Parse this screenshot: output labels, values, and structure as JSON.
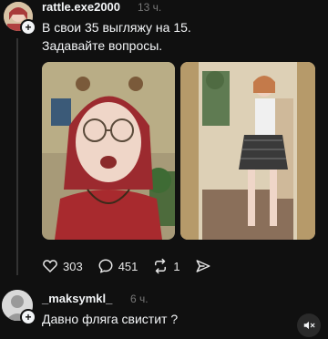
{
  "post": {
    "username": "rattle.exe2000",
    "time": "13 ч.",
    "text_line1": "В свои 35 выгляжу на 15.",
    "text_line2": "Задавайте вопросы.",
    "likes": "303",
    "comments": "451",
    "reposts": "1"
  },
  "reply": {
    "username": "_maksymkl_",
    "time": "6 ч.",
    "text": "Давно фляга свистит ?"
  },
  "icons": {
    "like": "heart-icon",
    "comment": "comment-icon",
    "repost": "repost-icon",
    "share": "send-icon",
    "mute": "speaker-muted-icon"
  },
  "colors": {
    "background": "#101010",
    "text": "#f3f5f7",
    "secondary": "#777777"
  }
}
